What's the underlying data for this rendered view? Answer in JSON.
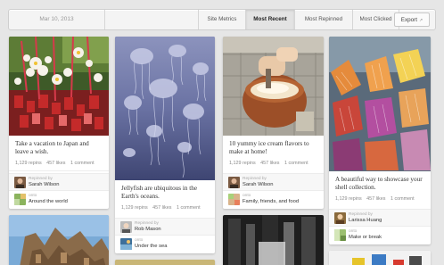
{
  "toolbar": {
    "date": "Mar 10, 2013",
    "tabs": [
      {
        "label": "Site Metrics",
        "active": false
      },
      {
        "label": "Most Recent",
        "active": true
      },
      {
        "label": "Most Repinned",
        "active": false
      },
      {
        "label": "Most Clicked",
        "active": false
      }
    ],
    "export_label": "Export",
    "export_icon": "external-link-icon"
  },
  "pins": [
    {
      "description": "Take a vacation to Japan and leave a wish.",
      "repins": "1,129 repins",
      "likes": "457 likes",
      "comments": "1 comment",
      "repinned_label": "Repinned by",
      "repinned_by": "Sarah Wilson",
      "board_label": "onto",
      "board": "Around the world"
    },
    {
      "description": "Jellyfish are ubiquitous in the Earth's oceans.",
      "repins": "1,129 repins",
      "likes": "457 likes",
      "comments": "1 comment",
      "repinned_label": "Repinned by",
      "repinned_by": "Rob Mason",
      "board_label": "onto",
      "board": "Under the sea"
    },
    {
      "description": "10 yummy ice cream flavors to make at home!",
      "repins": "1,129 repins",
      "likes": "457 likes",
      "comments": "1 comment",
      "repinned_label": "Repinned by",
      "repinned_by": "Sarah Wilson",
      "board_label": "onto",
      "board": "Family, friends, and food"
    },
    {
      "description": "A beautiful way to showcase your shell collection.",
      "repins": "1,129 repins",
      "likes": "457 likes",
      "comments": "1 comment",
      "repinned_label": "Repinned by",
      "repinned_by": "Larissa Huang",
      "board_label": "onto",
      "board": "Make or break"
    }
  ]
}
